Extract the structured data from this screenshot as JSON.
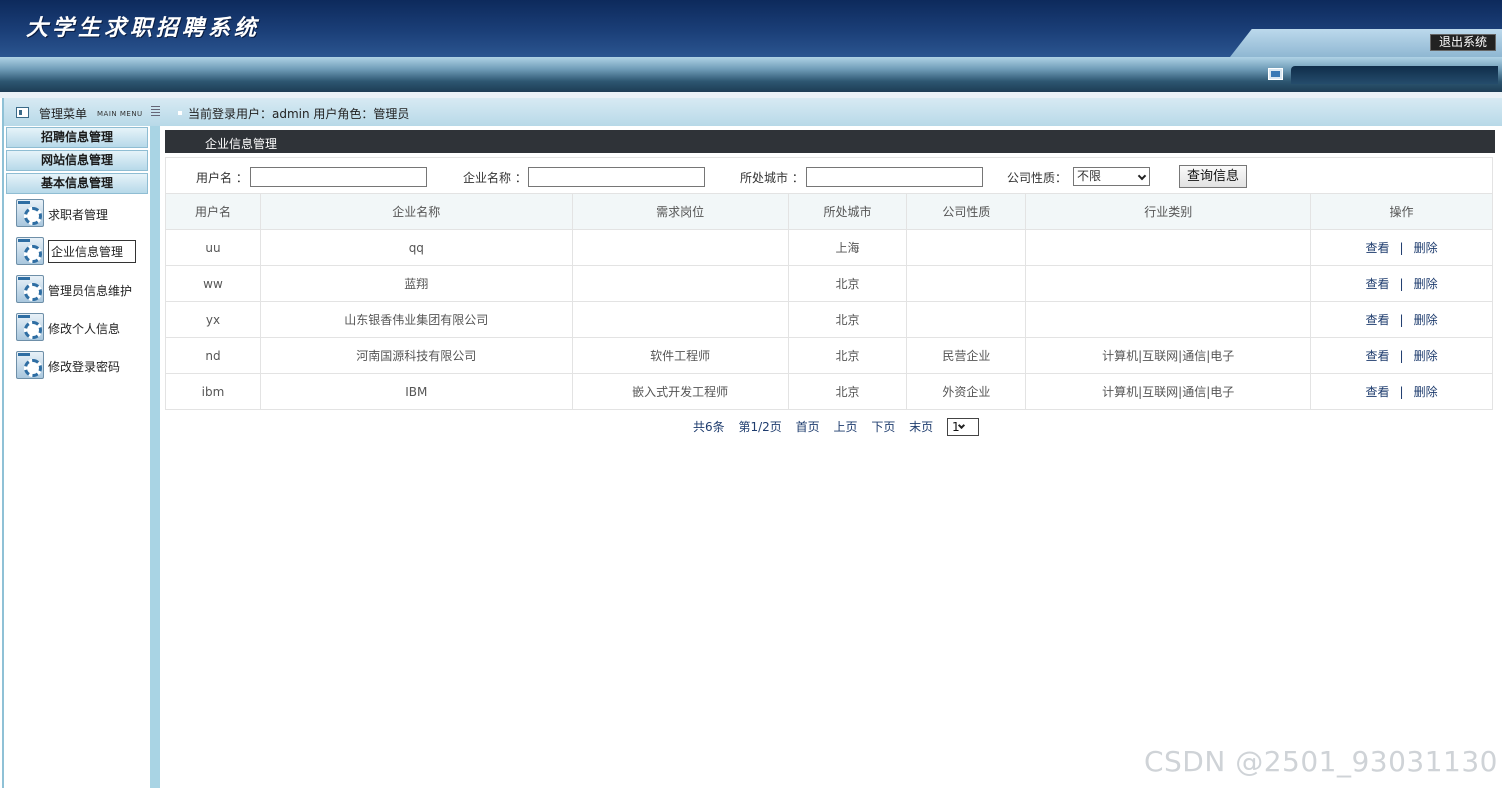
{
  "header": {
    "title": "大学生求职招聘系统",
    "logout_label": "退出系统"
  },
  "menu": {
    "title": "管理菜单",
    "title_en": "MAIN MENU",
    "groups": [
      {
        "label": "招聘信息管理"
      },
      {
        "label": "网站信息管理"
      },
      {
        "label": "基本信息管理"
      }
    ],
    "items": [
      {
        "label": "求职者管理"
      },
      {
        "label": "企业信息管理"
      },
      {
        "label": "管理员信息维护"
      },
      {
        "label": "修改个人信息"
      },
      {
        "label": "修改登录密码"
      }
    ]
  },
  "info": {
    "text": "当前登录用户：admin  用户角色：管理员"
  },
  "section": {
    "title": "企业信息管理"
  },
  "search": {
    "username_label": "用户名 ：",
    "company_label": "企业名称 ：",
    "city_label": "所处城市 ：",
    "nature_label": "公司性质：",
    "nature_selected": "不限",
    "button_label": "查询信息"
  },
  "table": {
    "headers": [
      "用户名",
      "企业名称",
      "需求岗位",
      "所处城市",
      "公司性质",
      "行业类别",
      "操作"
    ],
    "rows": [
      {
        "username": "uu",
        "company": "qq",
        "position": "",
        "city": "上海",
        "nature": "",
        "industry": ""
      },
      {
        "username": "ww",
        "company": "蓝翔",
        "position": "",
        "city": "北京",
        "nature": "",
        "industry": ""
      },
      {
        "username": "yx",
        "company": "山东银香伟业集团有限公司",
        "position": "",
        "city": "北京",
        "nature": "",
        "industry": ""
      },
      {
        "username": "nd",
        "company": "河南国源科技有限公司",
        "position": "软件工程师",
        "city": "北京",
        "nature": "民营企业",
        "industry": "计算机|互联网|通信|电子"
      },
      {
        "username": "ibm",
        "company": "IBM",
        "position": "嵌入式开发工程师",
        "city": "北京",
        "nature": "外资企业",
        "industry": "计算机|互联网|通信|电子"
      }
    ],
    "view_label": "查看",
    "sep_label": "|",
    "delete_label": "删除"
  },
  "pager": {
    "total": "共6条",
    "page": "第1/2页",
    "first": "首页",
    "prev": "上页",
    "next": "下页",
    "last": "末页",
    "selected": "1"
  },
  "watermark": {
    "text": "CSDN @2501_93031130"
  }
}
